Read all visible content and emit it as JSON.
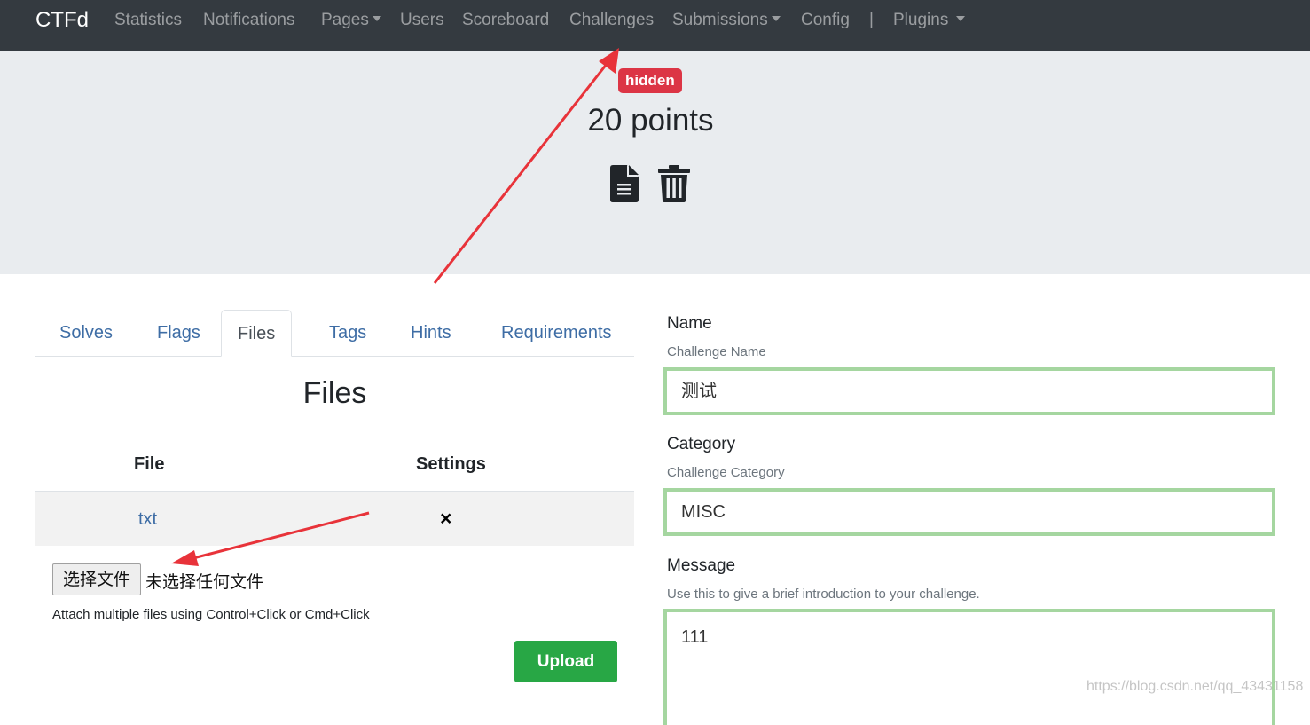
{
  "navbar": {
    "brand": "CTFd",
    "items": [
      {
        "label": "Statistics"
      },
      {
        "label": "Notifications"
      },
      {
        "label": "Pages"
      },
      {
        "label": "Users"
      },
      {
        "label": "Scoreboard"
      },
      {
        "label": "Challenges"
      },
      {
        "label": "Submissions"
      },
      {
        "label": "Config"
      },
      {
        "label": "|"
      },
      {
        "label": "Plugins"
      }
    ]
  },
  "header": {
    "badge": "hidden",
    "points": "20 points",
    "icons": [
      "file-icon",
      "trash-icon"
    ]
  },
  "tabs": [
    {
      "label": "Solves"
    },
    {
      "label": "Flags"
    },
    {
      "label": "Files"
    },
    {
      "label": "Tags"
    },
    {
      "label": "Hints"
    },
    {
      "label": "Requirements"
    }
  ],
  "files": {
    "title": "Files",
    "columns": [
      "File",
      "Settings"
    ],
    "rows": [
      {
        "name": "txt",
        "action": "×"
      }
    ],
    "choose_button": "选择文件",
    "no_file": "未选择任何文件",
    "help": "Attach multiple files using Control+Click or Cmd+Click",
    "upload": "Upload"
  },
  "form": {
    "name_label": "Name",
    "name_help": "Challenge Name",
    "name_value": "测试",
    "category_label": "Category",
    "category_help": "Challenge Category",
    "category_value": "MISC",
    "message_label": "Message",
    "message_help": "Use this to give a brief introduction to your challenge.",
    "message_value": "111"
  },
  "watermark": "https://blog.csdn.net/qq_43431158",
  "colors": {
    "navbar": "#343a40",
    "jumbotron": "#e9ecef",
    "badge": "#dc3545",
    "link": "#3e6da5",
    "upload": "#28a745",
    "field_border": "#a5d6a0",
    "annotation_arrow": "#e8333a"
  }
}
